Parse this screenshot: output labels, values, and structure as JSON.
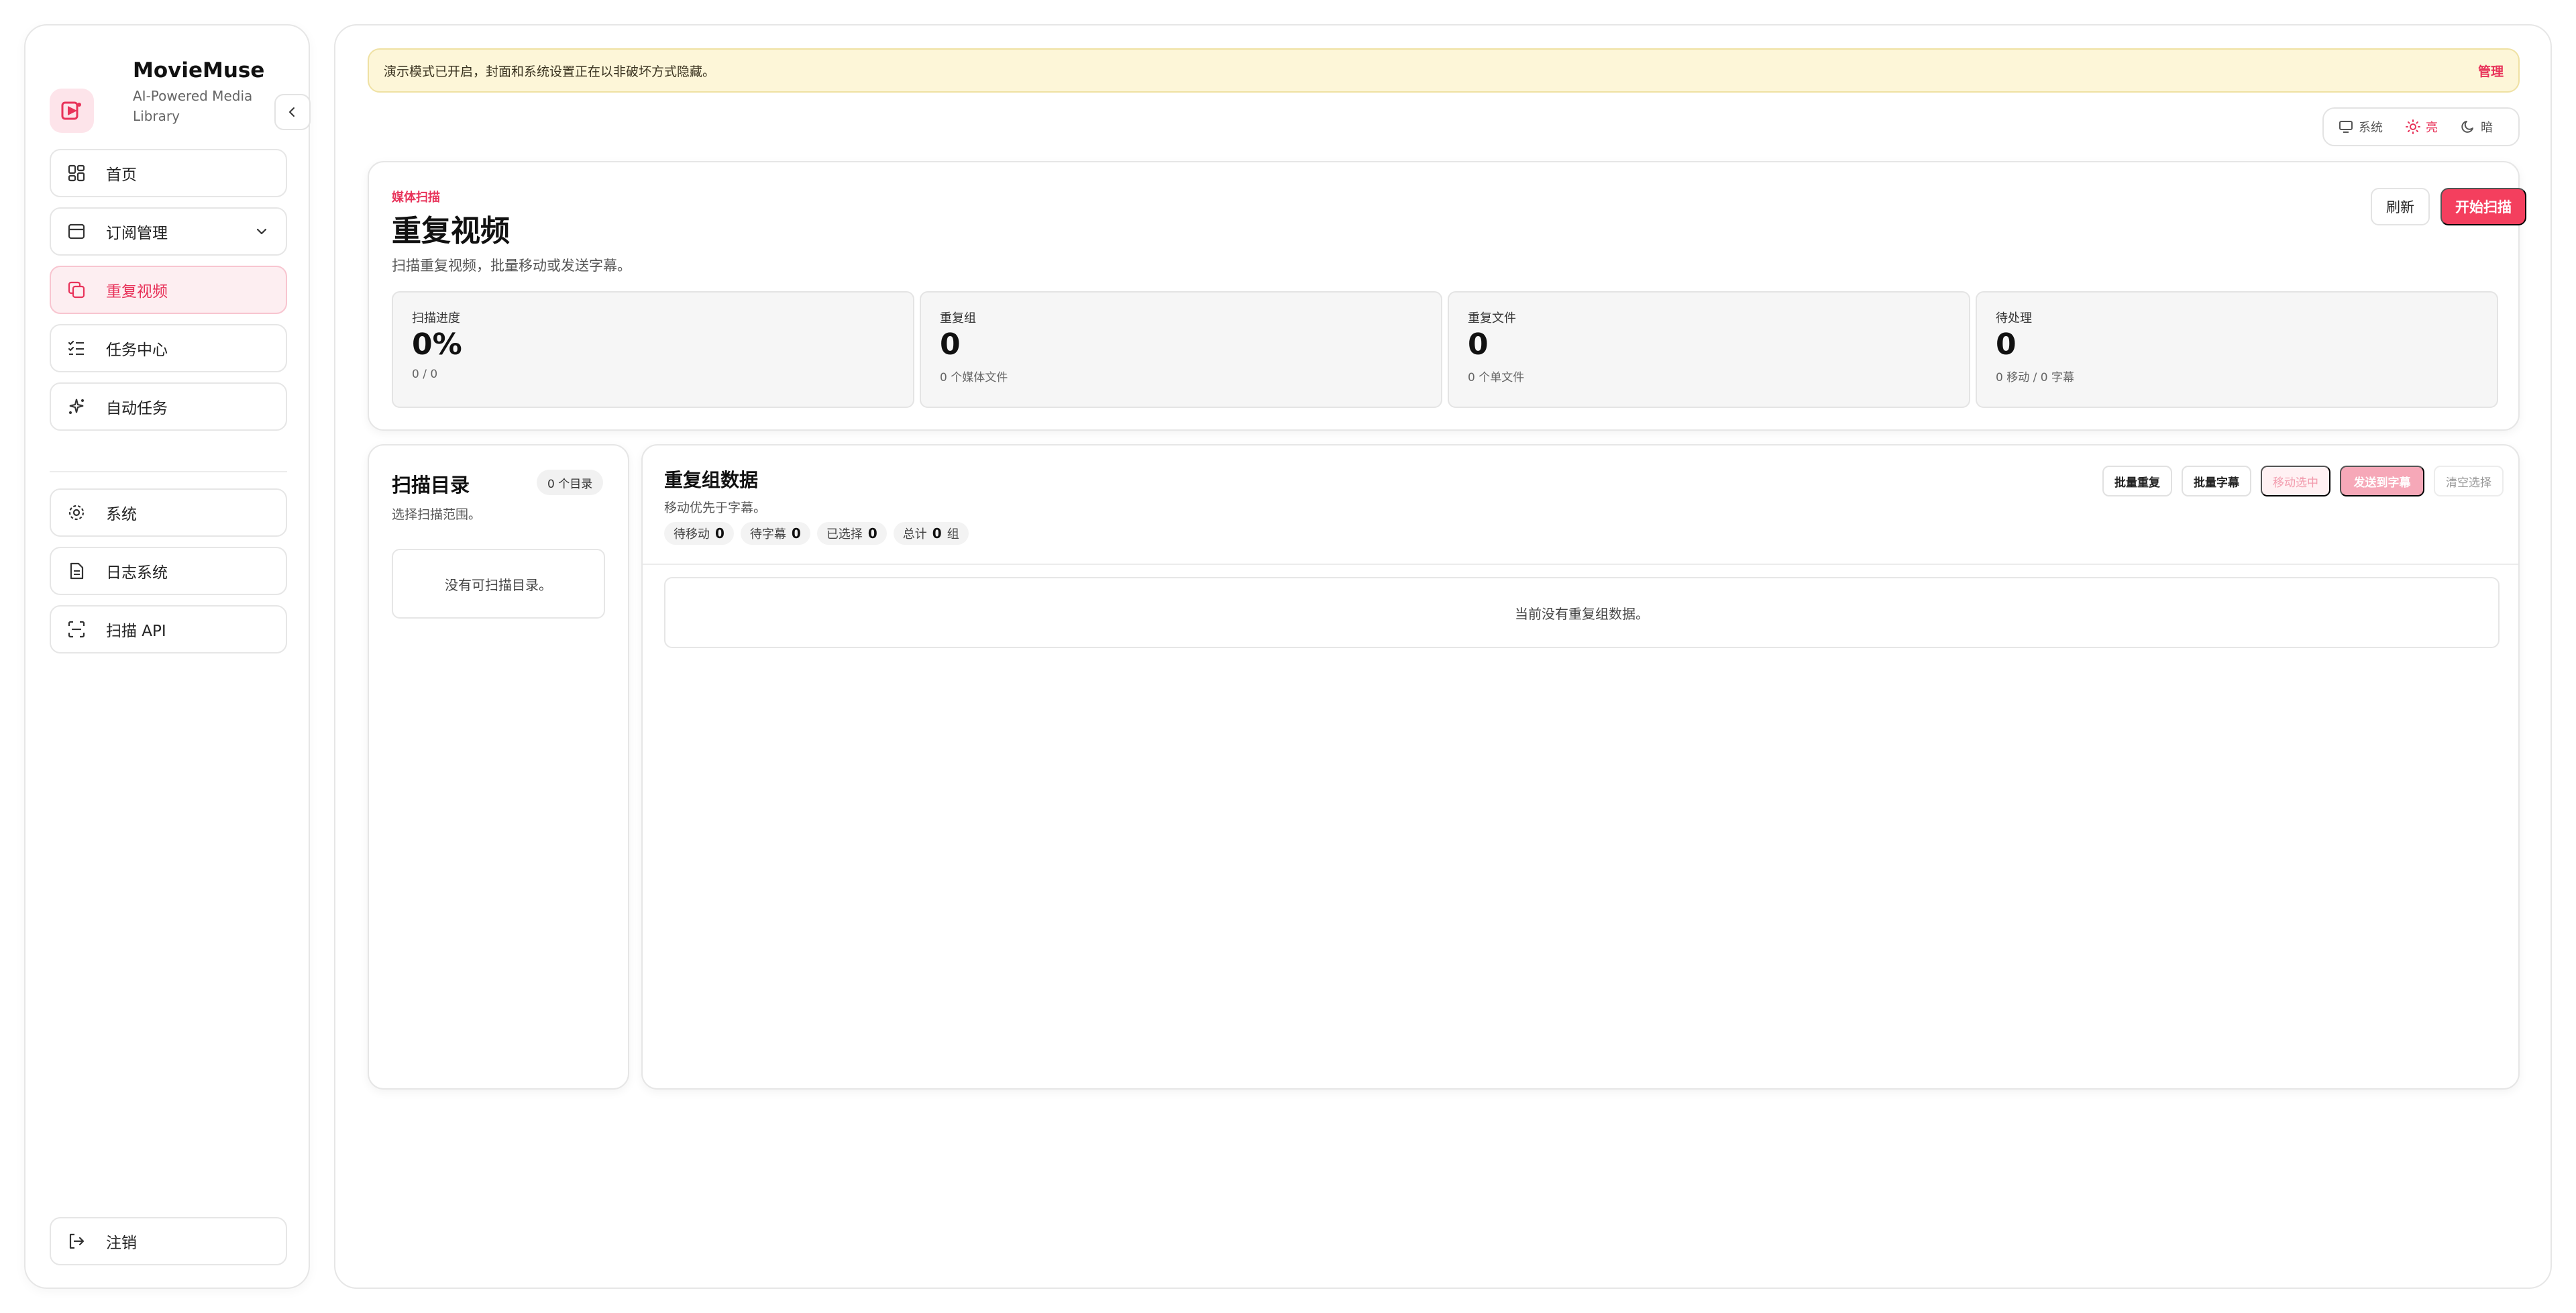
{
  "brand": {
    "name": "MovieMuse",
    "subtitle": "AI-Powered Media Library"
  },
  "nav": {
    "items": [
      {
        "label": "首页",
        "icon": "dashboard-icon"
      },
      {
        "label": "订阅管理",
        "icon": "calendar-icon",
        "expandable": true
      },
      {
        "label": "重复视频",
        "icon": "copy-icon",
        "active": true
      },
      {
        "label": "任务中心",
        "icon": "checklist-icon"
      },
      {
        "label": "自动任务",
        "icon": "sparkles-icon"
      },
      {
        "label": "系统",
        "icon": "gear-icon"
      },
      {
        "label": "日志系统",
        "icon": "document-icon"
      },
      {
        "label": "扫描 API",
        "icon": "scan-icon"
      }
    ],
    "logout": {
      "label": "注销",
      "icon": "logout-icon"
    }
  },
  "banner": {
    "text": "演示模式已开启，封面和系统设置正在以非破坏方式隐藏。",
    "link": "管理"
  },
  "theme": {
    "options": [
      "系统",
      "亮",
      "暗"
    ],
    "selected": "亮"
  },
  "hero": {
    "eyebrow": "媒体扫描",
    "title": "重复视频",
    "description": "扫描重复视频，批量移动或发送字幕。",
    "refresh_label": "刷新",
    "scan_label": "开始扫描"
  },
  "stats": [
    {
      "label": "扫描进度",
      "value": "0%",
      "sub": "0 / 0"
    },
    {
      "label": "重复组",
      "value": "0",
      "sub": "0 个媒体文件"
    },
    {
      "label": "重复文件",
      "value": "0",
      "sub": "0 个单文件"
    },
    {
      "label": "待处理",
      "value": "0",
      "sub": "0 移动 / 0 字幕"
    }
  ],
  "directories": {
    "title": "扫描目录",
    "badge": "0 个目录",
    "description": "选择扫描范围。",
    "empty": "没有可扫描目录。"
  },
  "groups": {
    "title": "重复组数据",
    "description": "移动优先于字幕。",
    "chips": [
      {
        "label": "待移动",
        "value": "0"
      },
      {
        "label": "待字幕",
        "value": "0"
      },
      {
        "label": "已选择",
        "value": "0"
      },
      {
        "label": "总计",
        "value": "0",
        "suffix": "组"
      }
    ],
    "actions": [
      "批量重复",
      "批量字幕",
      "移动选中",
      "发送到字幕",
      "清空选择"
    ],
    "empty": "当前没有重复组数据。"
  },
  "colors": {
    "accent": "#f43f5e",
    "accent_soft": "#fdeef1",
    "banner_bg": "#fdf6d8"
  }
}
